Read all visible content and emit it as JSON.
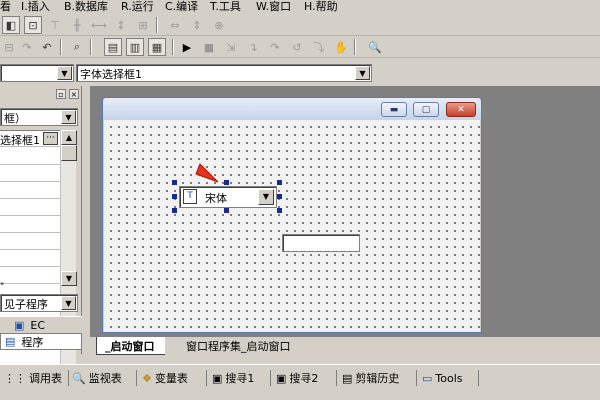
{
  "menu": {
    "items": [
      "看",
      "I.插入",
      "B.数据库",
      "R.运行",
      "C.编译",
      "T.工具",
      "W.窗口",
      "H.帮助"
    ]
  },
  "toolbar": {
    "font_selector_combo": "字体选择框1"
  },
  "left_panel": {
    "object_combo": "框）",
    "selected_property": "选择框1",
    "event_combo": "见子程序",
    "tabs": [
      "EC",
      "程序"
    ]
  },
  "canvas": {
    "font_combo_value": "宋体"
  },
  "window_tabs": [
    "_启动窗口",
    "窗口程序集_启动窗口"
  ],
  "bottom_tabs": [
    "调用表",
    "监视表",
    "变量表",
    "搜寻1",
    "搜寻2",
    "剪辑历史",
    "Tools"
  ],
  "colors": {
    "canvas_bg": "#f2f2f2",
    "title_gradient": "#c6d4ea",
    "close_button": "#c8402a",
    "pointer_arrow": "#e8341c",
    "selection_handle": "#1a2a8a"
  }
}
